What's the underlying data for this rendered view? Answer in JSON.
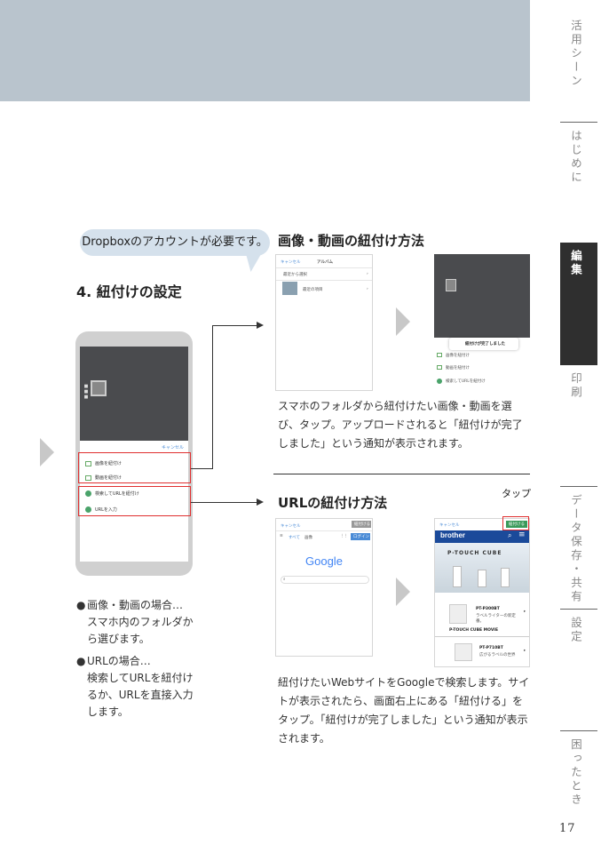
{
  "sidebar": {
    "tabs": [
      {
        "label": "活用シーン",
        "active": false
      },
      {
        "label": "はじめに",
        "active": false
      },
      {
        "label": "編集",
        "active": true
      },
      {
        "label": "印刷",
        "active": false
      },
      {
        "label": "データ保存・共有",
        "active": false
      },
      {
        "label": "設定",
        "active": false
      },
      {
        "label": "困ったとき",
        "active": false
      }
    ],
    "page_number": "17"
  },
  "callout": "Dropboxのアカウントが必要です。",
  "step_title": "4. 紐付けの設定",
  "phone": {
    "cancel": "キャンセル",
    "items": [
      "画像を紐付け",
      "動画を紐付け",
      "検索してURLを紐付け",
      "URLを入力"
    ]
  },
  "notes": [
    {
      "bullet": "●",
      "text": "画像・動画の場合…\nスマホ内のフォルダか\nら選びます。"
    },
    {
      "bullet": "●",
      "text": "URLの場合…\n検索してURLを紐付け\nるか、URLを直接入力\nします。"
    }
  ],
  "section1": {
    "title": "画像・動画の紐付け方法",
    "screen_a": {
      "cancel": "キャンセル",
      "header": "アルバム",
      "row1": "最近から選択",
      "row2": "最近の項目"
    },
    "screen_b": {
      "toast": "紐付けが完了しました",
      "items": [
        "画像を紐付け",
        "動画を紐付け",
        "検索してURLを紐付け"
      ]
    },
    "description": "スマホのフォルダから紐付けたい画像・動画を選び、タップ。アップロードされると「紐付けが完了しました」という通知が表示されます。"
  },
  "section2": {
    "title": "URLの紐付け方法",
    "tap": "タップ",
    "screen_a": {
      "cancel": "キャンセル",
      "link_btn": "紐付ける",
      "tab_all": "すべて",
      "tab_images": "画像",
      "login": "ログイン",
      "logo": "Google"
    },
    "screen_b": {
      "cancel": "キャンセル",
      "link_btn": "紐付ける",
      "brand": "brother",
      "banner": "P-TOUCH CUBE",
      "product1": "PT-P300BT",
      "product1_desc": "ラベルライターの新定番。",
      "product1_link": "P-TOUCH CUBE MOVIE",
      "product2": "PT-P710BT",
      "product2_desc": "広がるラベルの世界"
    },
    "description": "紐付けたいWebサイトをGoogleで検索します。サイトが表示されたら、画面右上にある「紐付ける」をタップ。「紐付けが完了しました」という通知が表示されます。"
  },
  "colors": {
    "accent_red": "#e03030",
    "banner": "#b9c4cd",
    "callout": "#d5e1ec",
    "sidebar_active": "#2f2f2f"
  }
}
